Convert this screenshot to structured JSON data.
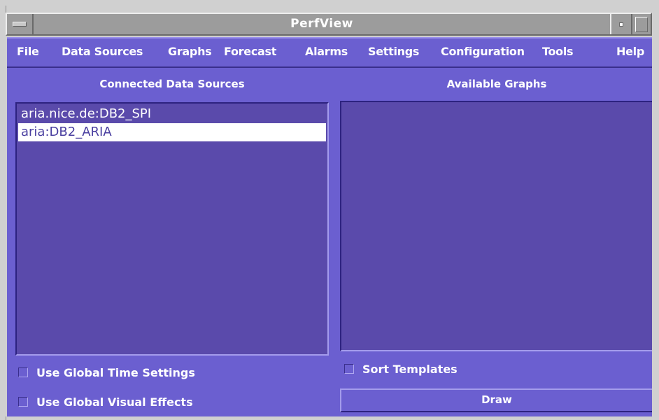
{
  "window": {
    "title": "PerfView"
  },
  "menu": {
    "items": [
      "File",
      "Data Sources",
      "Graphs",
      "Forecast",
      "Alarms",
      "Settings",
      "Configuration",
      "Tools",
      "Help"
    ]
  },
  "left_panel": {
    "title": "Connected Data Sources",
    "items": [
      {
        "label": "aria.nice.de:DB2_SPI",
        "selected": false
      },
      {
        "label": "aria:DB2_ARIA",
        "selected": true
      }
    ],
    "options": [
      {
        "label": "Use Global Time Settings",
        "checked": false
      },
      {
        "label": "Use Global Visual Effects",
        "checked": false
      }
    ]
  },
  "right_panel": {
    "title": "Available Graphs",
    "items": [],
    "sort_templates": {
      "label": "Sort Templates",
      "checked": false
    },
    "draw_button": "Draw"
  },
  "colors": {
    "client_bg": "#6b5fd0",
    "list_bg": "#5a4aab",
    "titlebar_bg": "#9c9c9c",
    "selection_bg": "#ffffff"
  }
}
